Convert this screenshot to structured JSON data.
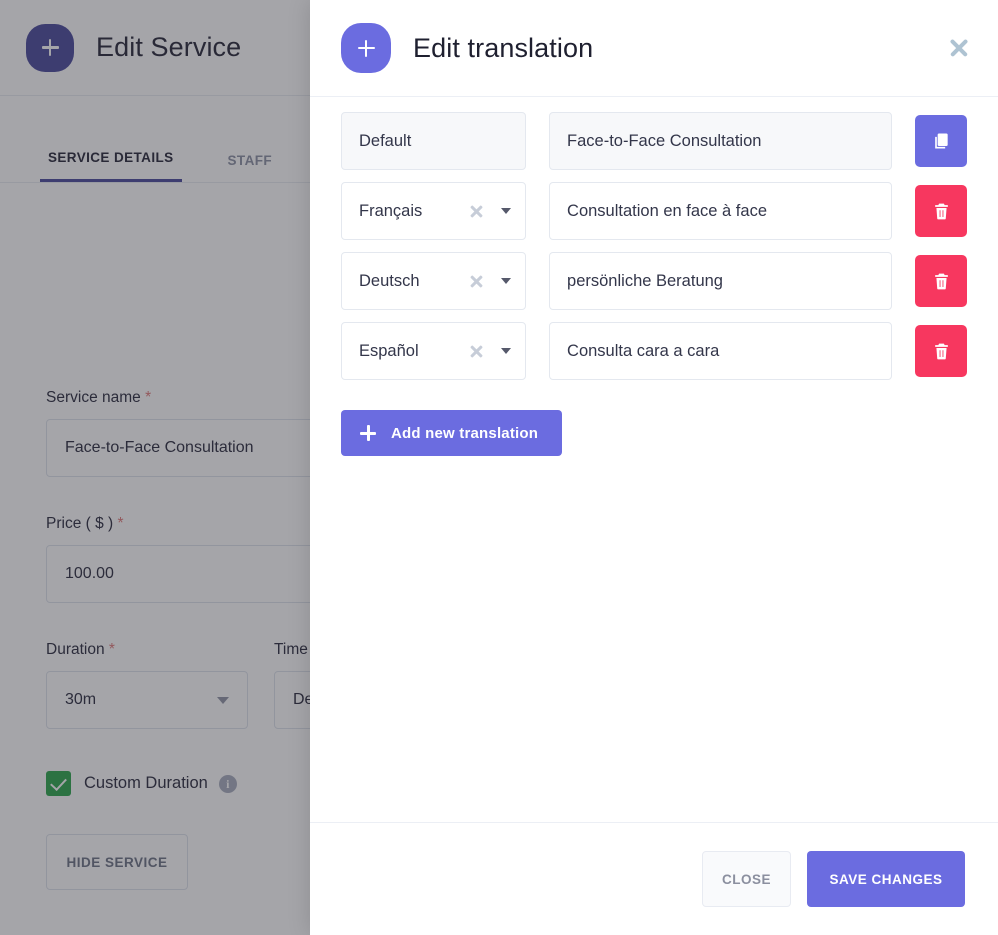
{
  "background": {
    "header": {
      "title": "Edit Service",
      "icon": "plus-squircle-icon"
    },
    "tabs": [
      {
        "label": "SERVICE DETAILS",
        "active": true
      },
      {
        "label": "STAFF",
        "active": false
      }
    ],
    "form": {
      "service_name_label": "Service name",
      "service_name_value": "Face-to-Face Consultation",
      "price_label": "Price ( $ )",
      "price_value": "100.00",
      "duration_label": "Duration",
      "duration_value": "30m",
      "timezone_label": "Time",
      "timezone_value": "De",
      "required_marker": "*",
      "custom_duration_label": "Custom Duration",
      "custom_duration_checked": true,
      "info_glyph": "i",
      "hide_service_label": "HIDE SERVICE"
    }
  },
  "modal": {
    "title": "Edit translation",
    "icon": "plus-squircle-icon",
    "close_icon": "close-icon",
    "rows": [
      {
        "language": "Default",
        "value": "Face-to-Face Consultation",
        "disabled": true,
        "action": "copy",
        "action_icon": "copy-icon"
      },
      {
        "language": "Français",
        "value": "Consultation en face à face",
        "disabled": false,
        "action": "delete",
        "action_icon": "trash-icon"
      },
      {
        "language": "Deutsch",
        "value": "persönliche Beratung",
        "disabled": false,
        "action": "delete",
        "action_icon": "trash-icon"
      },
      {
        "language": "Español",
        "value": "Consulta cara a cara",
        "disabled": false,
        "action": "delete",
        "action_icon": "trash-icon"
      }
    ],
    "add_button_label": "Add new translation",
    "footer": {
      "close_label": "CLOSE",
      "save_label": "SAVE CHANGES"
    }
  },
  "colors": {
    "accent_purple": "#6b6ce0",
    "dark_purple": "#4c4c9d",
    "danger_red": "#f7375f",
    "success_green": "#2fa84f",
    "overlay": "#28282f"
  }
}
